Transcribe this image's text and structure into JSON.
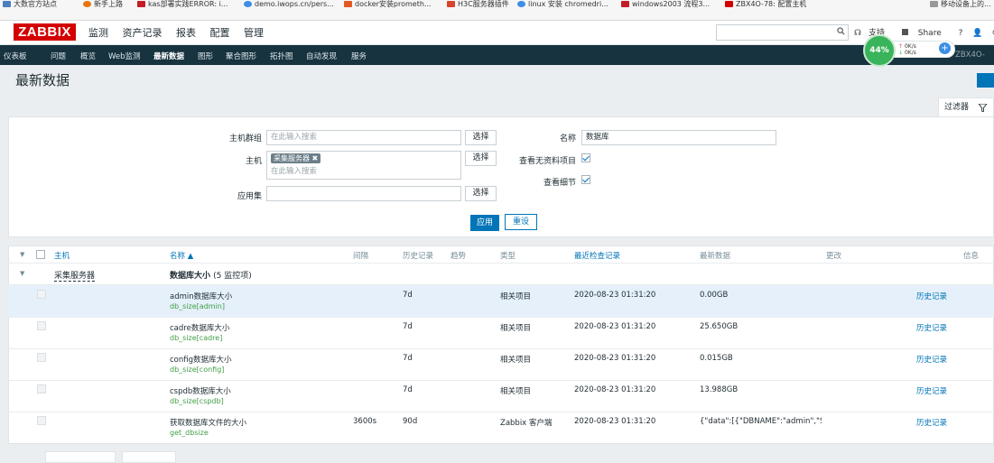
{
  "bookmarks": [
    {
      "label": "大数官方站点",
      "color": "#4a7fc1"
    },
    {
      "label": "新手上路",
      "color": "#e8740c"
    },
    {
      "label": "kas部署实践ERROR: i...",
      "color": "#c41d26"
    },
    {
      "label": "demo.iwops.cn/pers...",
      "color": "#3d8ee4"
    },
    {
      "label": "docker安装prometh...",
      "color": "#e25822"
    },
    {
      "label": "H3C服务器插件",
      "color": "#d8452c"
    },
    {
      "label": "linux 安装 chromedri...",
      "color": "#3d8ee4"
    },
    {
      "label": "windows2003 流程3...",
      "color": "#c41d26"
    },
    {
      "label": "ZBX4O-78: 配置主机",
      "color": "#d40000"
    },
    {
      "label": "移动设备上的...",
      "color": "#999999"
    }
  ],
  "app": {
    "logo": "ZABBIX",
    "main_menu": [
      "监测",
      "资产记录",
      "报表",
      "配置",
      "管理"
    ],
    "top_right": {
      "support": "支持",
      "share": "Share",
      "help": "?"
    },
    "sub_menu": [
      "仪表板",
      "问题",
      "概览",
      "Web监测",
      "最新数据",
      "图形",
      "聚合图形",
      "拓扑图",
      "自动发现",
      "服务"
    ],
    "sub_menu_active": "最新数据",
    "sub_menu_right": "ZBX4O-",
    "speed": {
      "percent": "44%",
      "up": "0K/s",
      "down": "0K/s"
    }
  },
  "page": {
    "title": "最新数据"
  },
  "filter": {
    "tab_label": "过滤器",
    "host_group_label": "主机群组",
    "host_group_placeholder": "在此输入搜索",
    "host_label": "主机",
    "host_tag": "采集服务器",
    "host_placeholder": "在此输入搜索",
    "app_label": "应用集",
    "select_label": "选择",
    "name_label": "名称",
    "name_value": "数据库",
    "show_no_data_label": "查看无资料项目",
    "show_no_data_checked": true,
    "show_details_label": "查看细节",
    "show_details_checked": true,
    "apply_label": "应用",
    "reset_label": "重设"
  },
  "table": {
    "headers": {
      "host": "主机",
      "name": "名称 ▲",
      "interval": "间隔",
      "history": "历史记录",
      "trends": "趋势",
      "type": "类型",
      "last_check": "最近检查记录",
      "last_value": "最新数据",
      "change": "更改",
      "info": "信息"
    },
    "group": {
      "host": "采集服务器",
      "title": "数据库大小",
      "count": "(5 监控项)"
    },
    "rows": [
      {
        "name": "admin数据库大小",
        "key": "db_size[admin]",
        "interval": "",
        "history": "7d",
        "type": "相关项目",
        "last_check": "2020-08-23 01:31:20",
        "last_value": "0.00GB",
        "link": "历史记录"
      },
      {
        "name": "cadre数据库大小",
        "key": "db_size[cadre]",
        "interval": "",
        "history": "7d",
        "type": "相关项目",
        "last_check": "2020-08-23 01:31:20",
        "last_value": "25.650GB",
        "link": "历史记录"
      },
      {
        "name": "config数据库大小",
        "key": "db_size[config]",
        "interval": "",
        "history": "7d",
        "type": "相关项目",
        "last_check": "2020-08-23 01:31:20",
        "last_value": "0.015GB",
        "link": "历史记录"
      },
      {
        "name": "cspdb数据库大小",
        "key": "db_size[cspdb]",
        "interval": "",
        "history": "7d",
        "type": "相关项目",
        "last_check": "2020-08-23 01:31:20",
        "last_value": "13.988GB",
        "link": "历史记录"
      },
      {
        "name": "获取数据库文件的大小",
        "key": "get_dbsize",
        "interval": "3600s",
        "history": "90d",
        "type": "Zabbix 客户端",
        "last_check": "2020-08-23 01:31:20",
        "last_value": "{\"data\":[{\"DBNAME\":\"admin\",\"SIZ...",
        "link": "历史记录"
      }
    ]
  },
  "colors": {
    "brand": "#d40000",
    "nav_dark": "#16333f",
    "link": "#0275b8",
    "key_green": "#429e47",
    "row_highlight": "#e5f0fa"
  }
}
